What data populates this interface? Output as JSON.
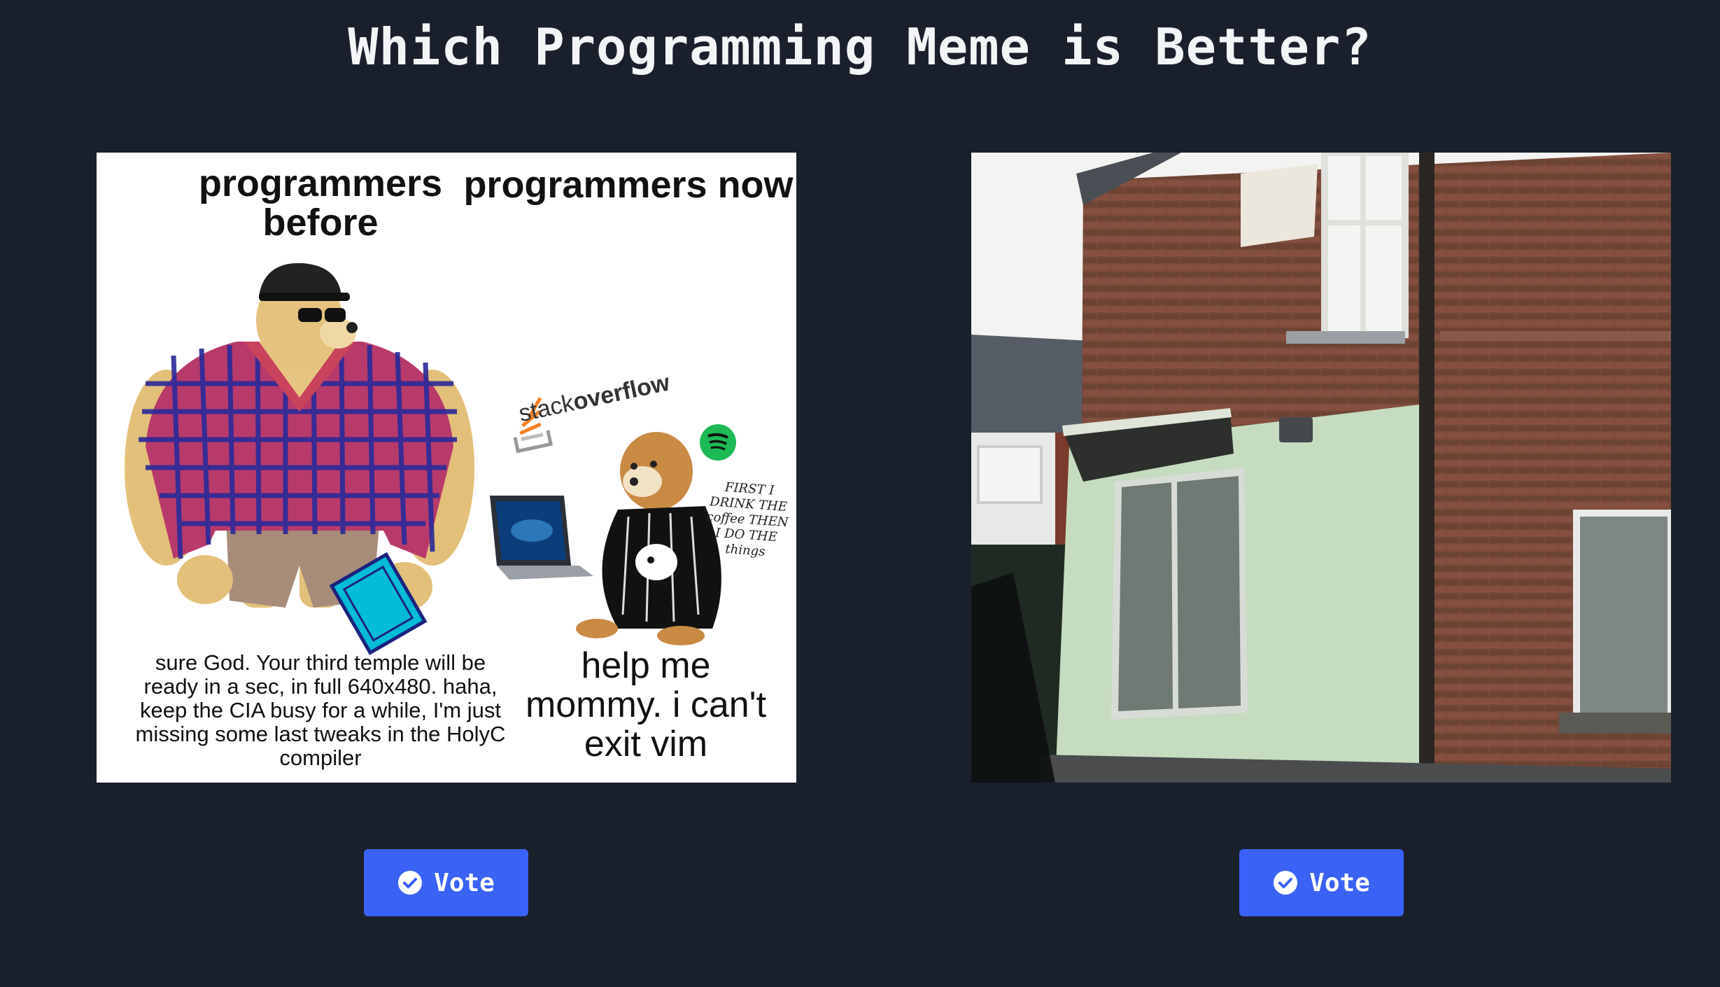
{
  "page": {
    "title": "Which Programming Meme is Better?"
  },
  "memes": [
    {
      "heading_before": "programmers before",
      "heading_now": "programmers now",
      "caption_before": "sure God. Your third temple will be ready in a sec, in full 640x480. haha, keep the CIA busy for a while, I'm just missing some last tweaks in the HolyC compiler",
      "caption_now": "help me mommy. i can't exit vim",
      "stack_prefix": "stack",
      "stack_suffix": "overflow",
      "coffee_note": "FIRST I DRINK THE coffee THEN I DO THE things"
    }
  ],
  "buttons": {
    "vote_label": "Vote"
  },
  "colors": {
    "background": "#1a1f2c",
    "button": "#3b62f6",
    "title": "#f3f4f6"
  },
  "icons": {
    "vote": "check-circle-icon"
  }
}
